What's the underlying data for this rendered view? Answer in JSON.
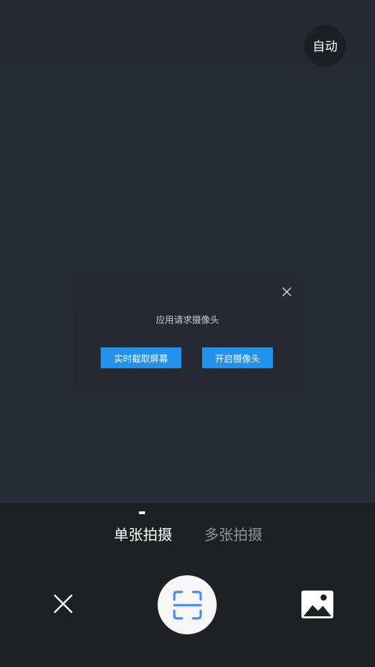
{
  "camera": {
    "auto_label": "自动"
  },
  "dialog": {
    "message": "应用请求摄像头",
    "screen_capture_label": "实时截取屏幕",
    "open_camera_label": "开启摄像头"
  },
  "modes": {
    "single_label": "单张拍摄",
    "multi_label": "多张拍摄",
    "active": "单张拍摄"
  },
  "colors": {
    "accent": "#2392ee",
    "shutter_icon": "#3d8ef0",
    "inactive_tab": "#8f9196"
  },
  "icons": {
    "dialog_close": "close-icon",
    "exit": "close-icon",
    "shutter": "scan-frame-icon",
    "gallery": "image-icon"
  }
}
